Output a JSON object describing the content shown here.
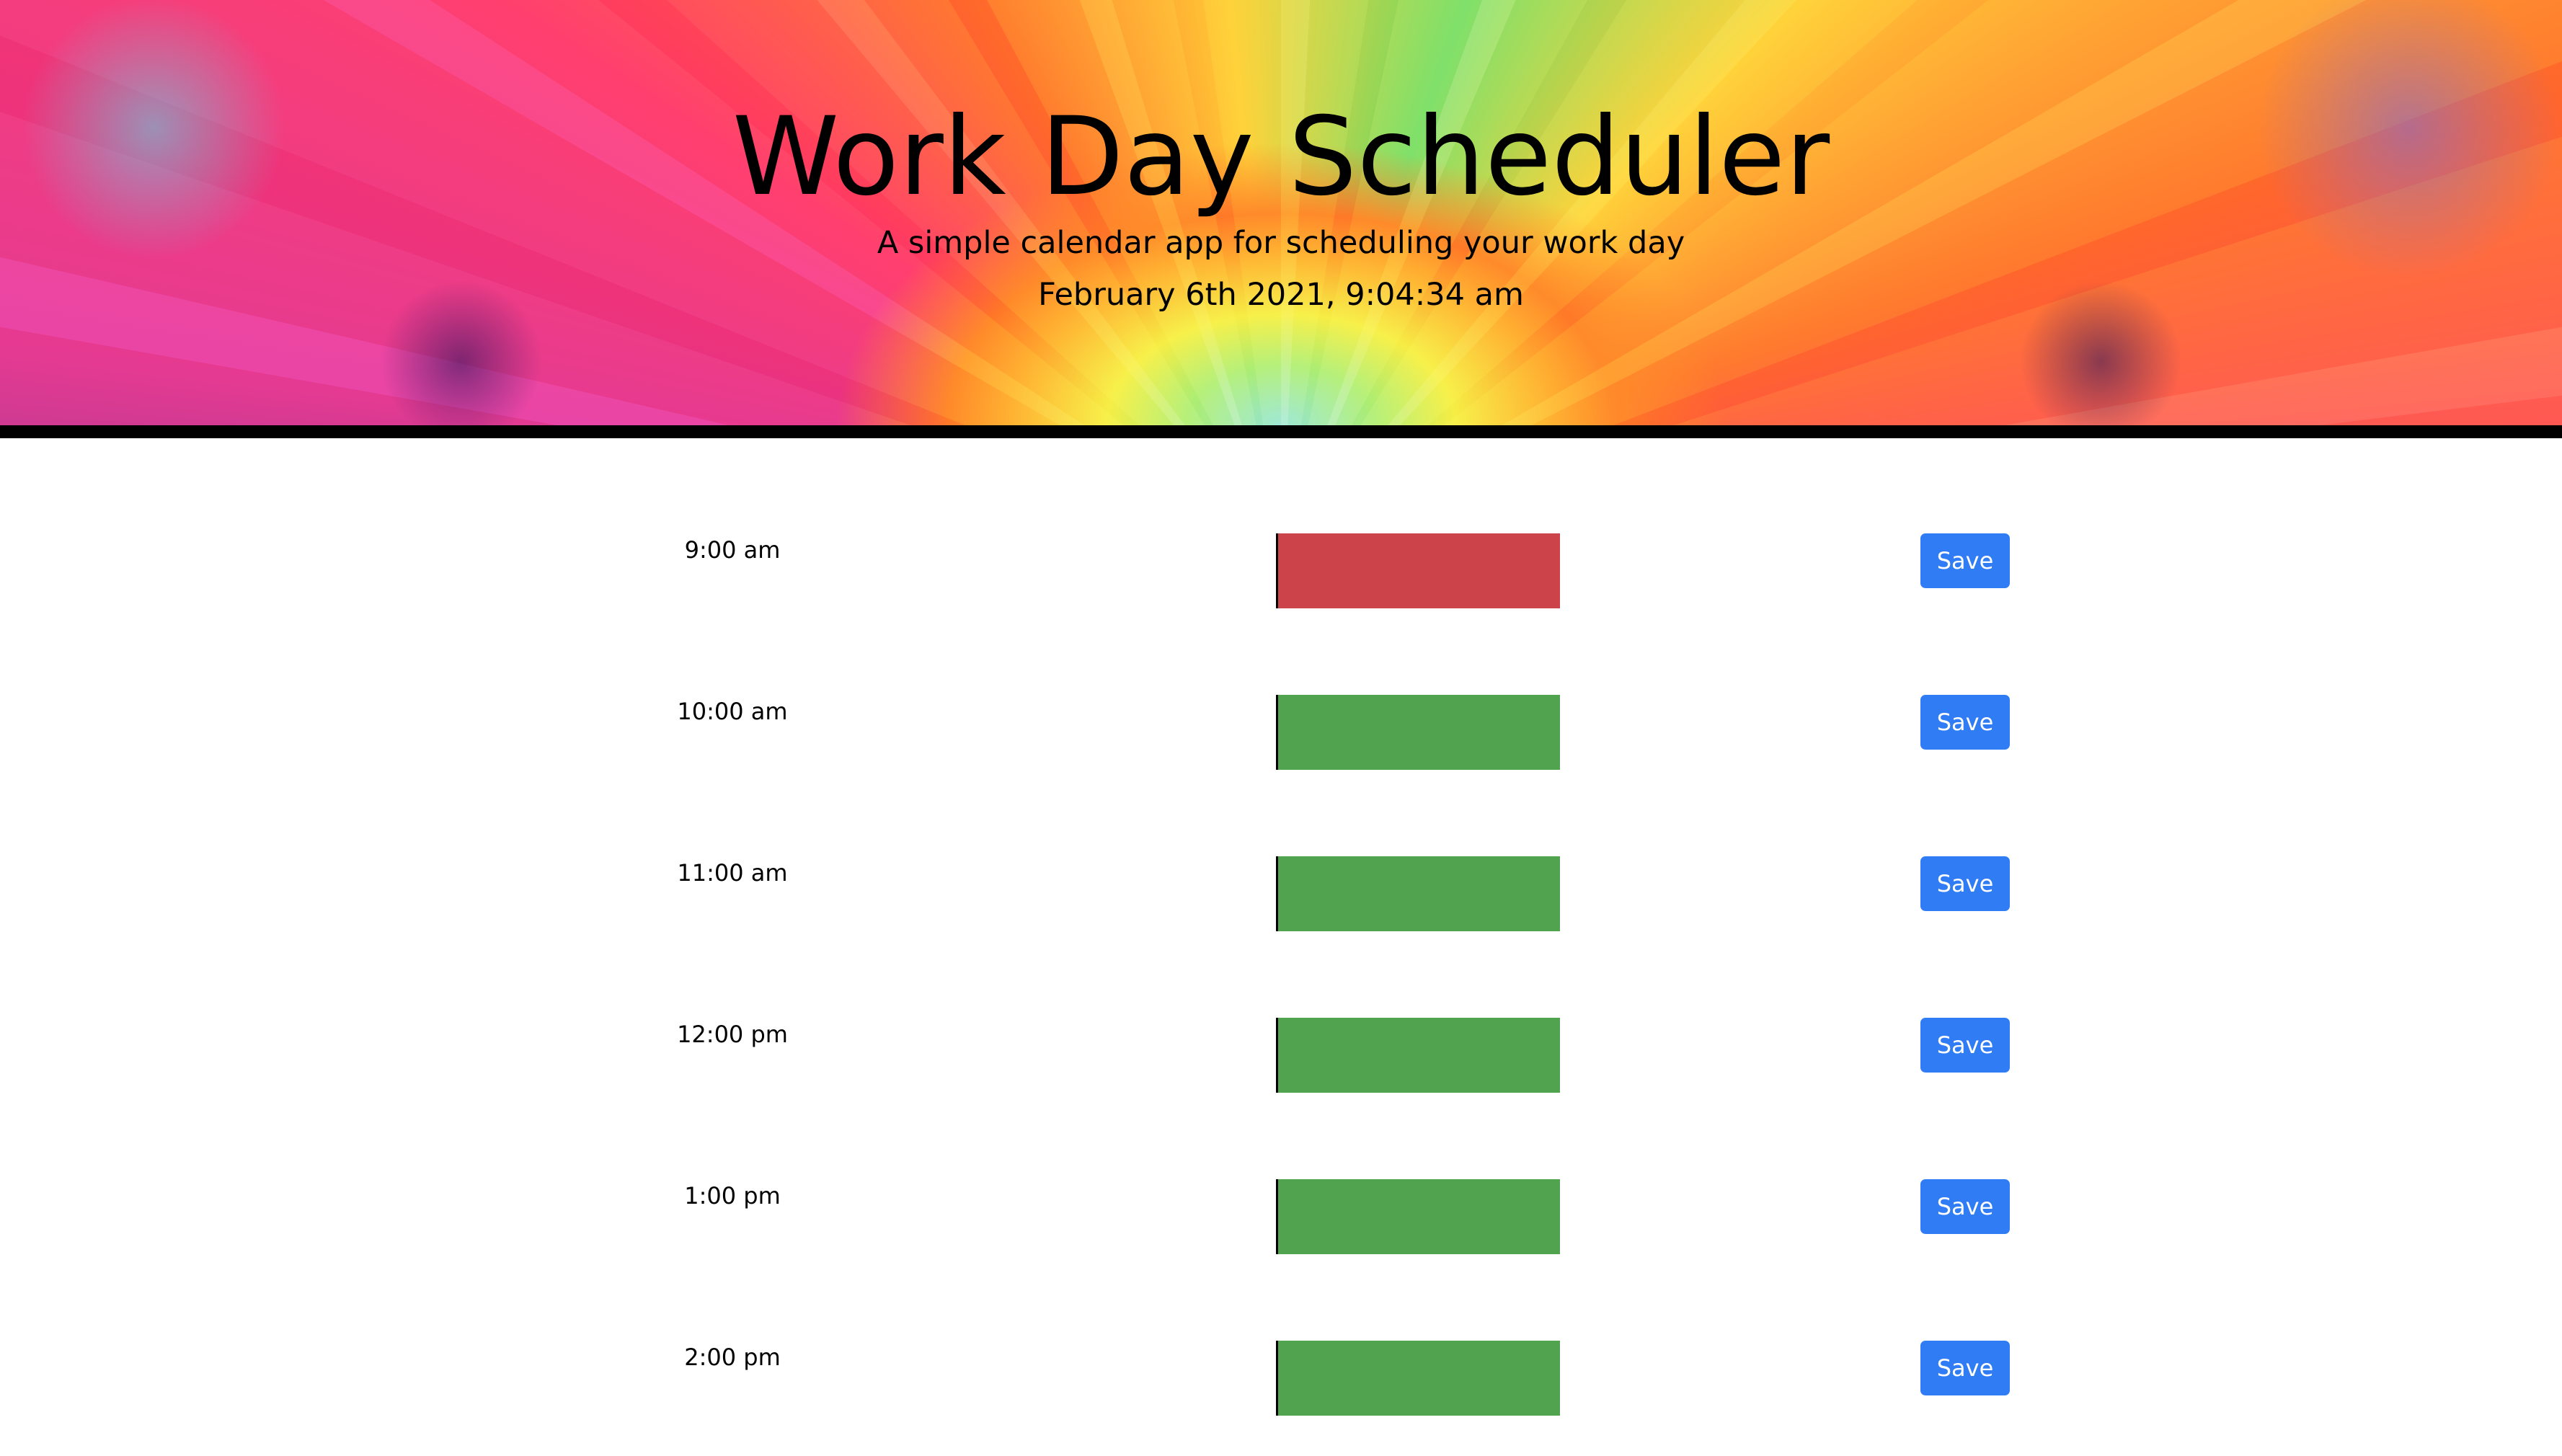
{
  "header": {
    "title": "Work Day Scheduler",
    "subtitle": "A simple calendar app for scheduling your work day",
    "current_datetime": "February 6th 2021, 9:04:34 am"
  },
  "schedule": {
    "rows": [
      {
        "hour": "9:00 am",
        "entry": "",
        "state": "past",
        "save_label": "Save"
      },
      {
        "hour": "10:00 am",
        "entry": "",
        "state": "future",
        "save_label": "Save"
      },
      {
        "hour": "11:00 am",
        "entry": "",
        "state": "future",
        "save_label": "Save"
      },
      {
        "hour": "12:00 pm",
        "entry": "",
        "state": "future",
        "save_label": "Save"
      },
      {
        "hour": "1:00 pm",
        "entry": "",
        "state": "future",
        "save_label": "Save"
      },
      {
        "hour": "2:00 pm",
        "entry": "",
        "state": "future",
        "save_label": "Save"
      }
    ]
  },
  "colors": {
    "past": "#cc4349",
    "future": "#51a350",
    "save_button": "#2f7cf5",
    "header_rule": "#000000"
  }
}
